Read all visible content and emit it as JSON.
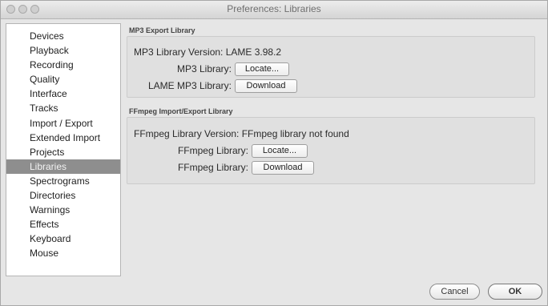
{
  "window": {
    "title": "Preferences: Libraries"
  },
  "sidebar": {
    "items": [
      {
        "label": "Devices"
      },
      {
        "label": "Playback"
      },
      {
        "label": "Recording"
      },
      {
        "label": "Quality"
      },
      {
        "label": "Interface"
      },
      {
        "label": "Tracks"
      },
      {
        "label": "Import / Export"
      },
      {
        "label": "Extended Import"
      },
      {
        "label": "Projects"
      },
      {
        "label": "Libraries",
        "selected": true
      },
      {
        "label": "Spectrograms"
      },
      {
        "label": "Directories"
      },
      {
        "label": "Warnings"
      },
      {
        "label": "Effects"
      },
      {
        "label": "Keyboard"
      },
      {
        "label": "Mouse"
      }
    ]
  },
  "mp3": {
    "section_title": "MP3 Export Library",
    "version_text": "MP3 Library Version: LAME 3.98.2",
    "library_label": "MP3 Library:",
    "locate_button": "Locate...",
    "lame_label": "LAME MP3 Library:",
    "download_button": "Download"
  },
  "ffmpeg": {
    "section_title": "FFmpeg Import/Export Library",
    "version_text": "FFmpeg Library Version: FFmpeg library not found",
    "library_label": "FFmpeg Library:",
    "locate_button": "Locate...",
    "download_label": "FFmpeg Library:",
    "download_button": "Download"
  },
  "buttons": {
    "cancel": "Cancel",
    "ok": "OK"
  }
}
